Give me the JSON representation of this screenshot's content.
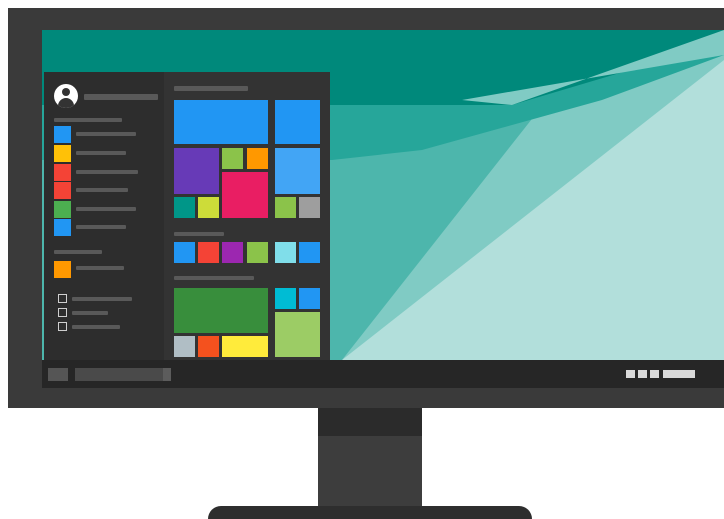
{
  "colors": {
    "bezel": "#3a3a3a",
    "taskbar": "#262626",
    "start_menu_bg": "#333333",
    "wallpaper_light": "#b2dfdb",
    "wallpaper_mid": "#80cbc4",
    "wallpaper_teal": "#26a69a",
    "wallpaper_dark": "#00897b"
  },
  "start_menu": {
    "app_list_icon_colors": [
      "#2196f3",
      "#ffc107",
      "#f44336",
      "#f44336",
      "#4caf50",
      "#2196f3"
    ],
    "recent_icon_color": "#ff9800",
    "checkbox_count": 3
  },
  "tiles": {
    "group1": [
      "#2196f3",
      "#2196f3",
      "#673ab7",
      "#8bc34a",
      "#ff9800",
      "#e91e63",
      "#42a5f5",
      "#009688",
      "#cddc39",
      "#8bc34a",
      "#9e9e9e"
    ],
    "group2": [
      "#2196f3",
      "#f44336",
      "#9c27b0",
      "#8bc34a",
      "#80deea",
      "#2196f3"
    ],
    "group3": [
      "#388e3c",
      "#00bcd4",
      "#2196f3",
      "#9ccc65",
      "#b0bec5",
      "#f4511e",
      "#ffeb3b"
    ]
  },
  "taskbar": {
    "tray_icon_count": 3
  },
  "icons": [
    "user-avatar-icon",
    "checkbox-icon",
    "start-button-icon",
    "search-box-icon",
    "tray-icon"
  ]
}
